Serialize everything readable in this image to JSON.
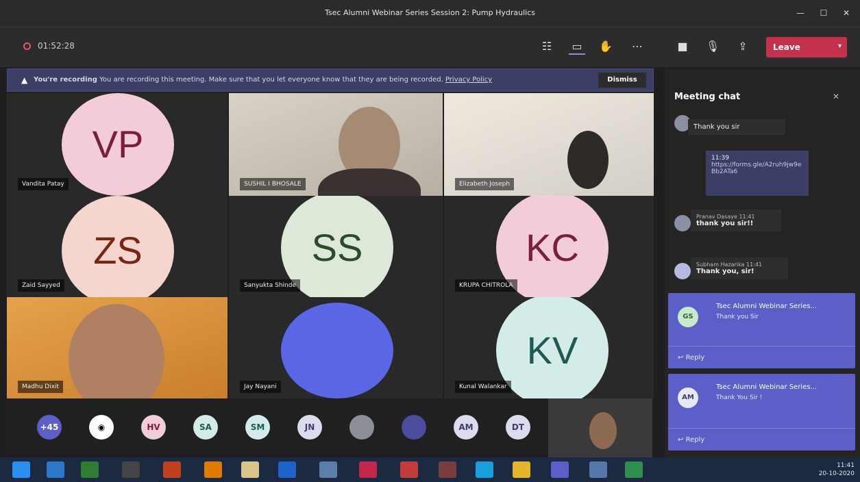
{
  "window": {
    "title": "Tsec Alumni Webinar Series Session 2: Pump Hydraulics"
  },
  "meeting": {
    "timer": "01:52:28",
    "leave_label": "Leave"
  },
  "banner": {
    "title": "You're recording",
    "text": "You are recording this meeting. Make sure that you let everyone know that they are being recorded.",
    "link": "Privacy Policy",
    "dismiss": "Dismiss"
  },
  "participants": [
    {
      "initials": "VP",
      "name": "Vandita Patay",
      "avatar_bg": "#f2ccd6",
      "avatar_fg": "#7b1e3d"
    },
    {
      "initials": "",
      "name": "SUSHIL I BHOSALE",
      "video": true
    },
    {
      "initials": "",
      "name": "Elizabeth Joseph",
      "video": true
    },
    {
      "initials": "ZS",
      "name": "Zaid Sayyed",
      "avatar_bg": "#f4d6cf",
      "avatar_fg": "#7a2412"
    },
    {
      "initials": "SS",
      "name": "Sanyukta Shinde",
      "avatar_bg": "#dde8d8",
      "avatar_fg": "#2e4a2a"
    },
    {
      "initials": "KC",
      "name": "KRUPA CHITROLA",
      "avatar_bg": "#f2ccd6",
      "avatar_fg": "#7b1e3d"
    },
    {
      "initials": "",
      "name": "Madhu Dixit",
      "video": true
    },
    {
      "initials": "",
      "name": "Jay Nayani",
      "video": true
    },
    {
      "initials": "KV",
      "name": "Kunal Walankar",
      "avatar_bg": "#d3ecea",
      "avatar_fg": "#1e5a52"
    }
  ],
  "strip": [
    "+45",
    "",
    "HV",
    "SA",
    "SM",
    "JN",
    "",
    "",
    "AM",
    "DT"
  ],
  "chat": {
    "header": "Meeting chat",
    "messages": [
      {
        "text": "Thank you sir"
      },
      {
        "time": "11:39",
        "text": "https://forms.gle/A2ruh9jw9eBb2ATa6"
      },
      {
        "name": "Pranav Dasaye",
        "time": "11:41",
        "text": "thank you sir!!"
      },
      {
        "name": "Subham Hazarika",
        "time": "11:41",
        "text": "Thank you, sir!"
      }
    ],
    "cards": [
      {
        "initials": "GS",
        "from": "Tsec Alumni Webinar Series...",
        "text": "Thank you Sir",
        "reply": "Reply"
      },
      {
        "initials": "AM",
        "from": "Tsec Alumni Webinar Series...",
        "text": "Thank You Sir !",
        "reply": "Reply"
      }
    ]
  },
  "clock": {
    "time": "11:41",
    "date": "20-10-2020"
  }
}
